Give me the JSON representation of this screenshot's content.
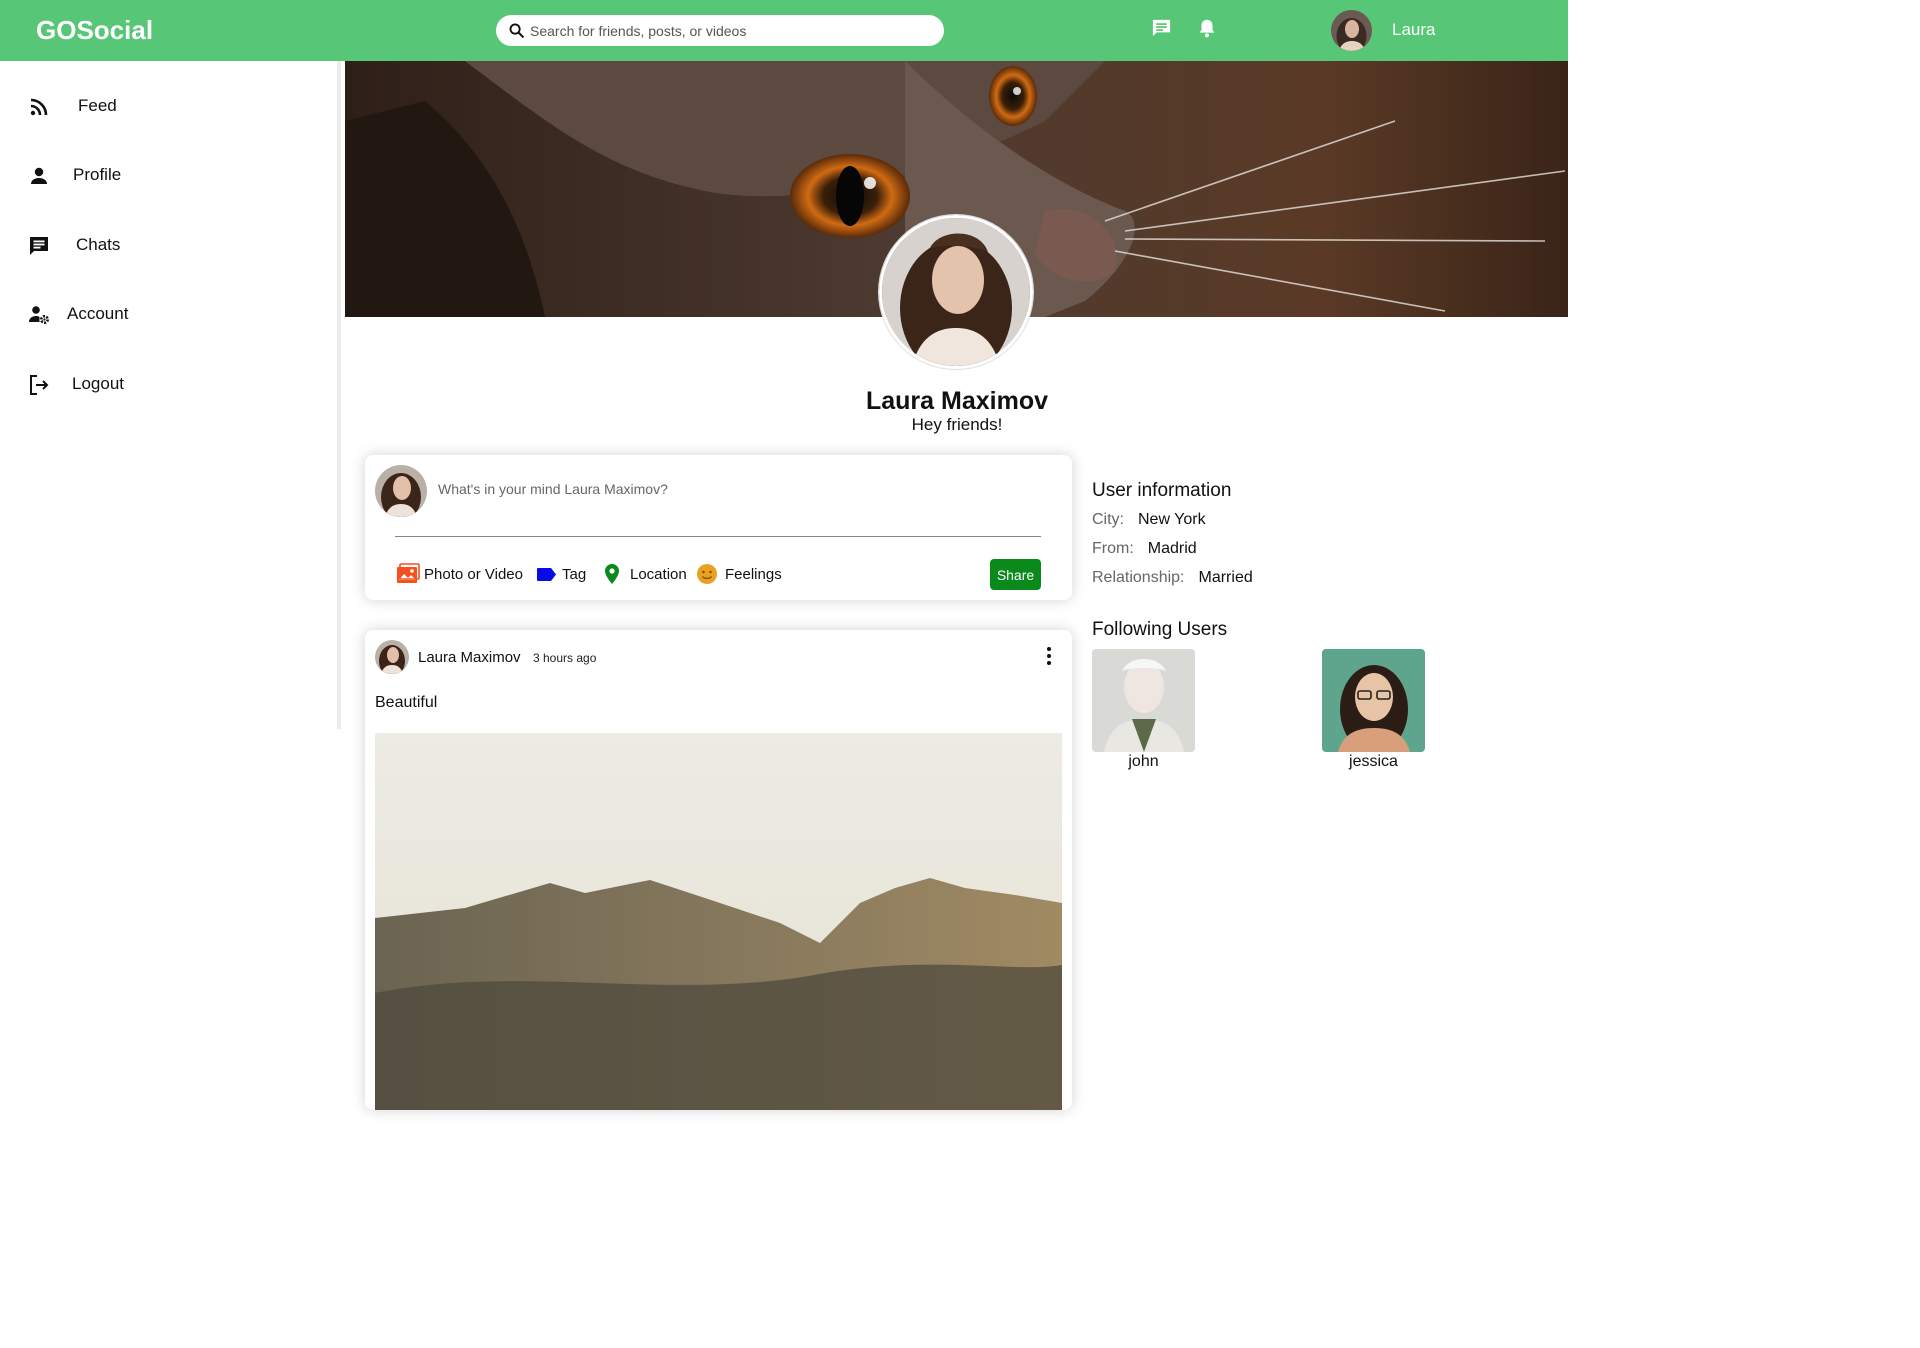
{
  "app": {
    "logo": "GOSocial",
    "accent": "#57c677"
  },
  "topbar": {
    "search_placeholder": "Search for friends, posts, or videos",
    "icons": [
      "chat-icon",
      "bell-icon"
    ],
    "username": "Laura"
  },
  "sidebar": {
    "items": [
      {
        "label": "Feed",
        "icon": "rss-icon"
      },
      {
        "label": "Profile",
        "icon": "person-icon"
      },
      {
        "label": "Chats",
        "icon": "chat-icon"
      },
      {
        "label": "Account",
        "icon": "user-settings-icon"
      },
      {
        "label": "Logout",
        "icon": "logout-icon"
      }
    ]
  },
  "profile": {
    "name": "Laura Maximov",
    "description": "Hey friends!"
  },
  "share": {
    "placeholder": "What's in your mind Laura Maximov?",
    "options": [
      {
        "label": "Photo or Video",
        "icon": "photo-icon",
        "color": "#f4511e"
      },
      {
        "label": "Tag",
        "icon": "tag-icon",
        "color": "#0a0ae6"
      },
      {
        "label": "Location",
        "icon": "location-pin-icon",
        "color": "#0a8a1e"
      },
      {
        "label": "Feelings",
        "icon": "smiley-icon",
        "color": "#e9a21f"
      }
    ],
    "button": "Share"
  },
  "post": {
    "user": "Laura Maximov",
    "time": "3 hours ago",
    "text": "Beautiful"
  },
  "user_info": {
    "title": "User information",
    "rows": [
      {
        "key": "City:",
        "value": "New York"
      },
      {
        "key": "From:",
        "value": "Madrid"
      },
      {
        "key": "Relationship:",
        "value": "Married"
      }
    ]
  },
  "following": {
    "title": "Following Users",
    "users": [
      {
        "name": "john"
      },
      {
        "name": "jessica"
      }
    ]
  }
}
